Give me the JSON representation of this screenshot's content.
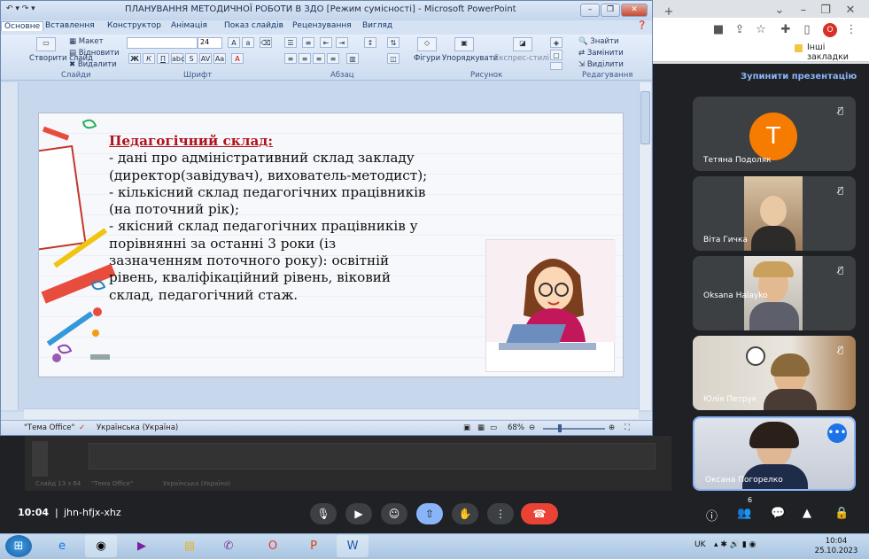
{
  "chrome": {
    "reload_icon": "plus-icon",
    "bookmarks_label": "Інші закладки",
    "avatar_letter": "O"
  },
  "ppt": {
    "title": "ПЛАНУВАННЯ МЕТОДИЧНОЇ РОБОТИ В ЗДО [Режим сумісності] - Microsoft PowerPoint",
    "tabs": [
      "Основне",
      "Вставлення",
      "Конструктор",
      "Анімація",
      "Показ слайдів",
      "Рецензування",
      "Вигляд"
    ],
    "ribbon": {
      "create_slide": "Створити слайд",
      "layout": "Макет",
      "reset": "Відновити",
      "delete": "Видалити",
      "font_size": "24",
      "shapes": "Фігури",
      "arrange": "Упорядкувати",
      "quick_styles": "Експрес-стилі",
      "find": "Знайти",
      "replace": "Замінити",
      "select": "Виділити",
      "groups": [
        "Слайди",
        "Шрифт",
        "Абзац",
        "Рисунок",
        "Редагування"
      ]
    },
    "status": {
      "theme": "\"Тема Office\"",
      "language": "Українська (Україна)",
      "zoom": "68%"
    },
    "slide": {
      "heading": "Педагогічний склад:",
      "lines": [
        "- дані про адміністративний склад закладу",
        "(директор(завідувач), вихователь-методист);",
        "- кількісний склад педагогічних працівників",
        "(на поточний рік);",
        "- якісний склад педагогічних працівників у",
        "порівнянні за останні 3 роки (із",
        "зазначенням поточного року): освітній",
        "рівень, кваліфікаційний рівень, віковий",
        "склад, педагогічний стаж."
      ]
    }
  },
  "meet": {
    "stop_presentation": "Зупинити презентацію",
    "meeting_time": "10:04",
    "meeting_code": "jhn-hfjx-xhz",
    "participants_count": "6",
    "participants": [
      {
        "name": "Тетяна Подоляк",
        "avatar_letter": "T",
        "avatar_color": "#f57c00"
      },
      {
        "name": "Віта Гичка"
      },
      {
        "name": "Oksana Halayko"
      },
      {
        "name": "Юлія Петрук"
      },
      {
        "name": "Оксана Погорелко"
      }
    ],
    "bg_status": {
      "slide": "Слайд 13 з 64",
      "theme": "\"Тема Office\"",
      "language": "Українська (Україна)"
    }
  },
  "taskbar": {
    "lang": "UK",
    "time": "10:04",
    "date": "25.10.2023"
  }
}
